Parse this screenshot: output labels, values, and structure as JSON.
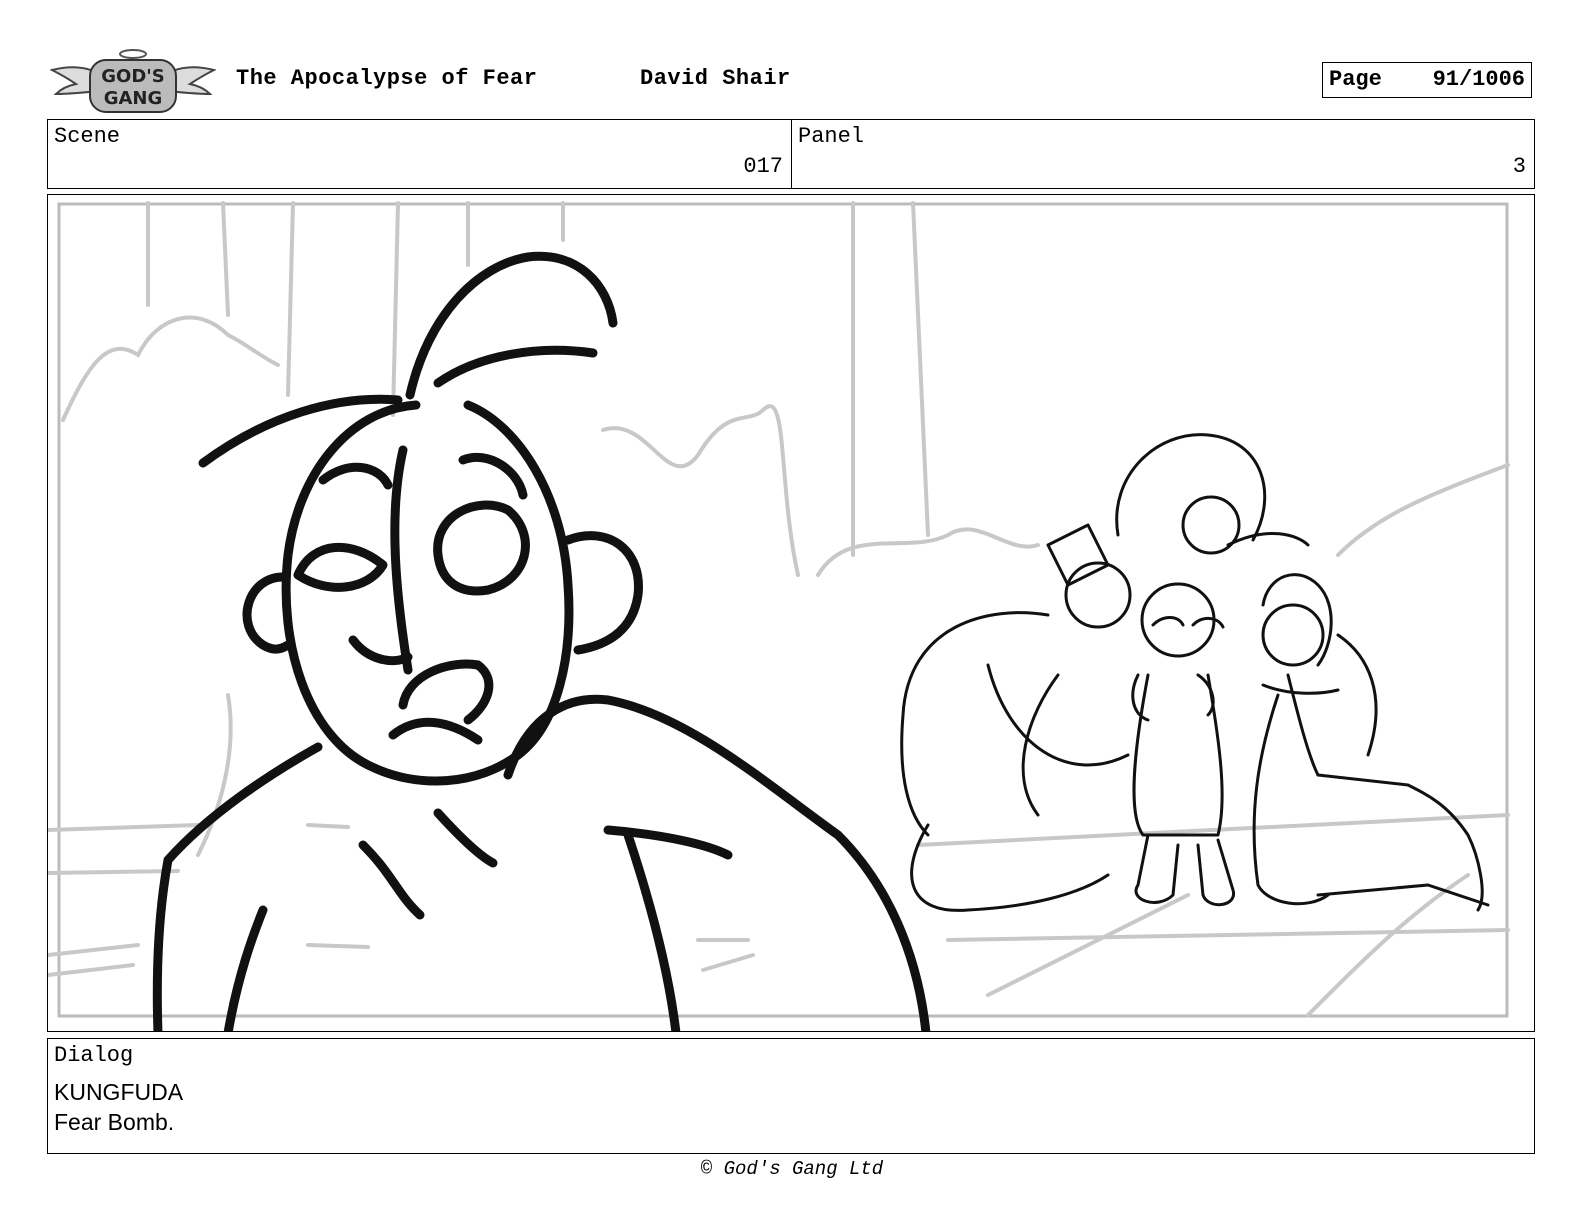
{
  "header": {
    "logo_text": "GOD'S GANG",
    "title": "The Apocalypse of Fear",
    "author": "David Shair",
    "page_label": "Page",
    "page_value": "91/1006"
  },
  "info": {
    "scene_label": "Scene",
    "scene_value": "017",
    "panel_label": "Panel",
    "panel_value": "3"
  },
  "dialog": {
    "label": "Dialog",
    "speaker": "KUNGFUDA",
    "line": "Fear Bomb."
  },
  "footer": {
    "copyright": "© God's Gang Ltd"
  }
}
